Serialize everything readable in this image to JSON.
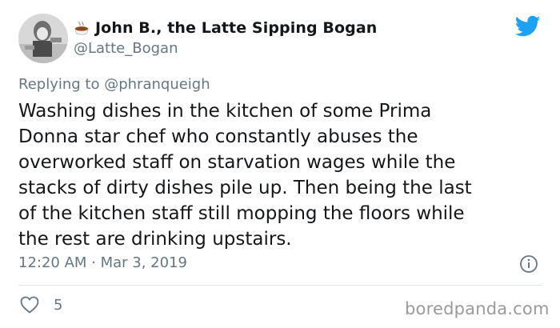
{
  "author": {
    "display_name": "John B., the Latte Sipping Bogan",
    "handle": "@Latte_Bogan",
    "name_emoji_icon": "latte-cup-icon"
  },
  "platform_icon": "twitter-bird-icon",
  "reply": {
    "prefix": "Replying to",
    "mention": "@phranqueigh"
  },
  "tweet": {
    "lines": [
      "Washing dishes in the kitchen of some Prima",
      "Donna star chef who constantly abuses the",
      "overworked staff on starvation wages while the",
      "stacks of dirty dishes pile up. Then being the last",
      "of the kitchen staff still mopping the floors while",
      "the rest are drinking upstairs."
    ],
    "timestamp": "12:20 AM · Mar 3, 2019"
  },
  "engagement": {
    "likes": "5"
  },
  "watermark": "boredpanda.com",
  "colors": {
    "twitter_blue": "#1da1f2",
    "muted_text": "#657786",
    "divider": "#e1e8ed"
  }
}
